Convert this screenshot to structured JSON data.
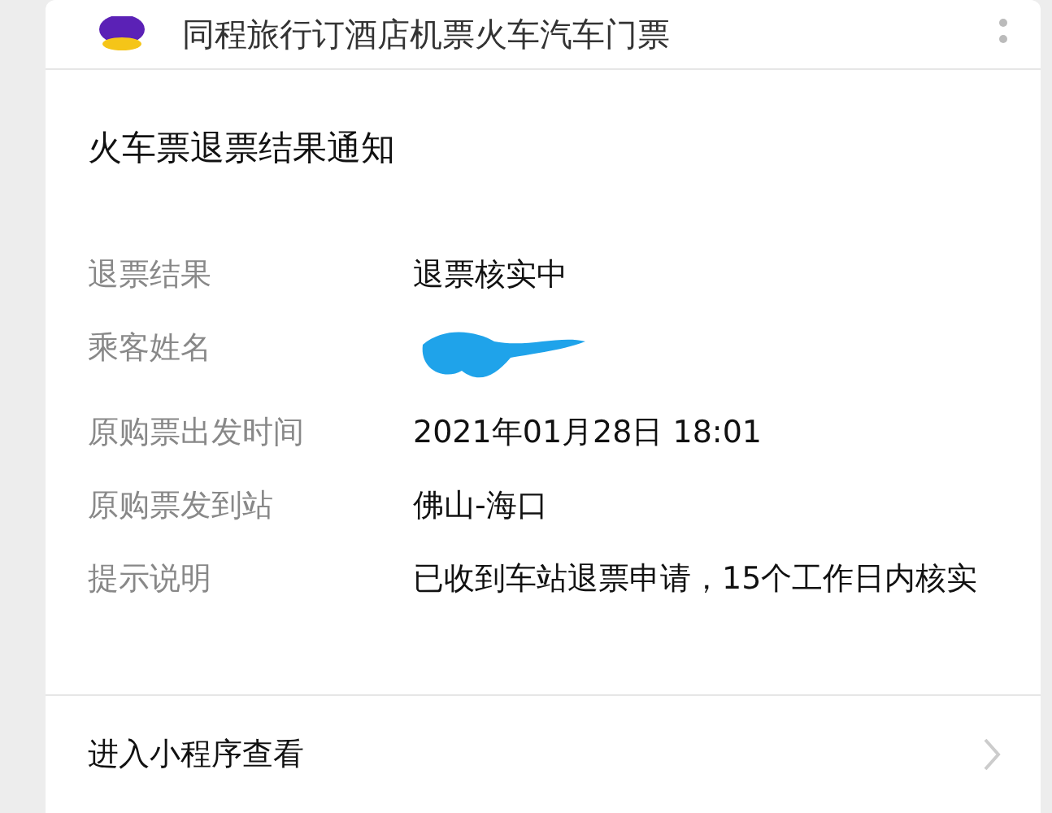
{
  "header": {
    "title": "同程旅行订酒店机票火车汽车门票"
  },
  "card": {
    "title": "火车票退票结果通知",
    "fields": [
      {
        "label": "退票结果",
        "value": "退票核实中",
        "kind": "text"
      },
      {
        "label": "乘客姓名",
        "kind": "redacted"
      },
      {
        "label": "原购票出发时间",
        "value": "2021年01月28日 18:01",
        "kind": "text"
      },
      {
        "label": "原购票发到站",
        "value": "佛山-海口",
        "kind": "text"
      },
      {
        "label": "提示说明",
        "value": "已收到车站退票申请，15个工作日内核实",
        "kind": "text"
      }
    ]
  },
  "footer": {
    "link": "进入小程序查看"
  }
}
